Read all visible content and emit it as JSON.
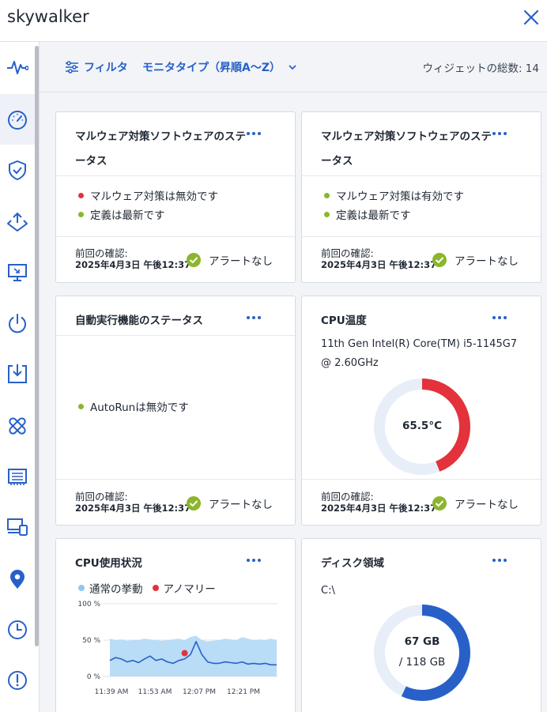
{
  "window": {
    "title": "skywalker",
    "close_icon": "close-icon"
  },
  "sidebar": {
    "items": [
      {
        "name": "activity",
        "icon": "pulse-icon",
        "active": false
      },
      {
        "name": "dashboard",
        "icon": "gauge-icon",
        "active": true
      },
      {
        "name": "security",
        "icon": "shield-icon",
        "active": false
      },
      {
        "name": "network",
        "icon": "share-icon",
        "active": false
      },
      {
        "name": "remote",
        "icon": "monitor-icon",
        "active": false
      },
      {
        "name": "power",
        "icon": "power-icon",
        "active": false
      },
      {
        "name": "install",
        "icon": "download-icon",
        "active": false
      },
      {
        "name": "patch",
        "icon": "patch-icon",
        "active": false
      },
      {
        "name": "hardware",
        "icon": "hardware-icon",
        "active": false
      },
      {
        "name": "devices",
        "icon": "devices-icon",
        "active": false
      },
      {
        "name": "location",
        "icon": "location-icon",
        "active": false
      },
      {
        "name": "history",
        "icon": "clock-icon",
        "active": false
      },
      {
        "name": "alerts",
        "icon": "alert-icon",
        "active": false
      }
    ]
  },
  "toolbar": {
    "filter_label": "フィルタ",
    "sort_label": "モニタタイプ（昇順A〜Z）",
    "widget_count_label": "ウィジェットの総数: 14"
  },
  "colors": {
    "accent": "#2860c8",
    "ok": "#8bb62c",
    "danger": "#e3323b",
    "track": "#e8eef8",
    "chart_fill": "#b9dcf7",
    "chart_line": "#2860c8"
  },
  "cards": {
    "antimalware1": {
      "title": "マルウェア対策ソフトウェアのステータス",
      "statuses": [
        {
          "text": "マルウェア対策は無効です",
          "color": "red"
        },
        {
          "text": "定義は最新です",
          "color": "green"
        }
      ],
      "last_check_label": "前回の確認:",
      "last_check_value": "2025年4月3日 午後12:37",
      "alert_text": "アラートなし"
    },
    "antimalware2": {
      "title": "マルウェア対策ソフトウェアのステータス",
      "statuses": [
        {
          "text": "マルウェア対策は有効です",
          "color": "green"
        },
        {
          "text": "定義は最新です",
          "color": "green"
        }
      ],
      "last_check_label": "前回の確認:",
      "last_check_value": "2025年4月3日 午後12:37",
      "alert_text": "アラートなし"
    },
    "autorun": {
      "title": "自動実行機能のステータス",
      "status": "AutoRunは無効です",
      "last_check_label": "前回の確認:",
      "last_check_value": "2025年4月3日 午後12:37",
      "alert_text": "アラートなし"
    },
    "cpu_temp": {
      "title": "CPU温度",
      "model_line1": "11th Gen Intel(R) Core(TM) i5-1145G7",
      "model_line2": "@ 2.60GHz",
      "temperature": "65.5°C",
      "gauge_fraction": 0.44,
      "last_check_label": "前回の確認:",
      "last_check_value": "2025年4月3日 午後12:37",
      "alert_text": "アラートなし"
    },
    "cpu_usage": {
      "title": "CPU使用状況",
      "legend_normal": "通常の挙動",
      "legend_anomaly": "アノマリー"
    },
    "disk": {
      "title": "ディスク領域",
      "drive": "C:\\",
      "used": "67 GB",
      "total": "/ 118 GB",
      "used_fraction": 0.57
    }
  },
  "chart_data": {
    "type": "area",
    "title": "CPU使用状況",
    "xlabel": "",
    "ylabel": "",
    "y_ticks": [
      "100 %",
      "50 %",
      "0 %"
    ],
    "x_ticks": [
      "11:39 AM",
      "11:53 AM",
      "12:07 PM",
      "12:21 PM"
    ],
    "ylim": [
      0,
      100
    ],
    "grid": true,
    "legend": "top-left",
    "series": [
      {
        "name": "通常の挙動",
        "kind": "band",
        "upper": [
          52,
          50,
          51,
          49,
          50,
          50,
          52,
          51,
          50,
          49,
          50,
          51,
          52,
          50,
          54,
          56,
          50,
          48,
          49,
          50,
          52,
          51,
          50,
          54,
          52,
          50,
          51,
          50,
          52,
          50
        ],
        "lower": [
          0,
          0,
          0,
          0,
          0,
          0,
          0,
          0,
          0,
          0,
          0,
          0,
          0,
          0,
          0,
          0,
          0,
          0,
          0,
          0,
          0,
          0,
          0,
          0,
          0,
          0,
          0,
          0,
          0,
          0
        ]
      },
      {
        "name": "",
        "kind": "line",
        "values": [
          22,
          26,
          24,
          20,
          22,
          19,
          24,
          28,
          22,
          24,
          20,
          18,
          22,
          24,
          30,
          48,
          30,
          20,
          18,
          18,
          20,
          19,
          18,
          20,
          17,
          18,
          17,
          18,
          16,
          16
        ]
      },
      {
        "name": "アノマリー",
        "kind": "points",
        "points": [
          {
            "index": 13,
            "value": 32
          }
        ]
      }
    ]
  }
}
